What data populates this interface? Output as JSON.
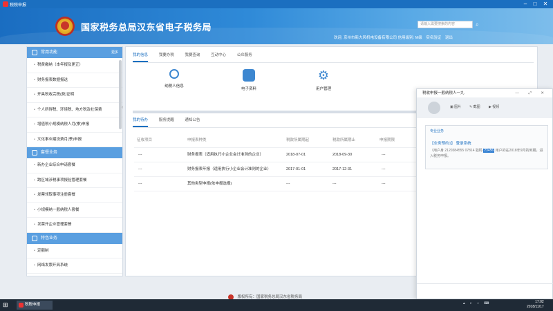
{
  "window": {
    "title": "税税申报"
  },
  "header": {
    "site_title": "国家税务总局汉东省电子税务局",
    "search_placeholder": "请输入需要搜索的内容",
    "welcome": "欢迎, 京州市新大风机电设备有限公司  信用级别: M级",
    "links": [
      "实名验证",
      "退出"
    ]
  },
  "sidebar": {
    "groups": [
      {
        "title": "常用功能",
        "more": "更多",
        "items": [
          "税费缴纳（本年报及更正）",
          "财务报表数据报送",
          "开具税收完税(费)证明",
          "个人所得税、环境税、地方税及社保费",
          "增值税小规模纳税人月(季)申报",
          "文化事业建设费月(季)申报"
        ]
      },
      {
        "title": "套餐业务",
        "items": [
          "新办企业综合申请套餐",
          "跨区域涉税事项报验管理套餐",
          "发票领取事项注册套餐",
          "小规模纳一般纳税人套餐",
          "发票开企业管理套餐"
        ]
      },
      {
        "title": "特色业务",
        "items": [
          "定额制",
          "网络发票开具系统"
        ]
      }
    ]
  },
  "main": {
    "tabs": [
      "我的信息",
      "我要办税",
      "我要查询",
      "互动中心",
      "公众服务"
    ],
    "quick": [
      {
        "icon": "person-icon",
        "label": "纳税人信息"
      },
      {
        "icon": "document-icon",
        "label": "电子资料"
      },
      {
        "icon": "gear-icon",
        "label": "用户管理"
      }
    ],
    "subtabs": [
      "我的待办",
      "服务提醒",
      "通知公告"
    ],
    "table": {
      "headers": [
        "征收项目",
        "申报表种类",
        "税款所属期起",
        "税款所属期止",
        "申报期限"
      ],
      "rows": [
        [
          "---",
          "财务报表（适用执行小企业会计准则的企业）",
          "2018-07-01",
          "2018-09-30",
          "---"
        ],
        [
          "---",
          "财务报表年报（适用执行小企业会计准则的企业）",
          "2017-01-01",
          "2017-12-31",
          "---"
        ],
        [
          "---",
          "其他类型申报(依申报选报)",
          "---",
          "---",
          "---"
        ]
      ]
    }
  },
  "chat": {
    "title": "税收申报一般纳税人一九",
    "controls": "— ⤢ ✕",
    "actions": [
      "图片",
      "截图",
      "视频"
    ],
    "card": {
      "tag": "专业业务",
      "title": "【业务预约1】 登录系统",
      "body_prefix": "（用户身份证号2014S5889 [1] (2)  用户",
      "body": "（用户身 2120384555 07814 验码 ",
      "highlight": "23456",
      "body_suffix": " 用户的在2018年9月的到期，进入税务申报。"
    }
  },
  "footer": {
    "text": "版权所有：国家税务总局汉东省税务局"
  },
  "taskbar": {
    "task": "税税申报",
    "time": "17:02",
    "date": "2018/11/17"
  }
}
